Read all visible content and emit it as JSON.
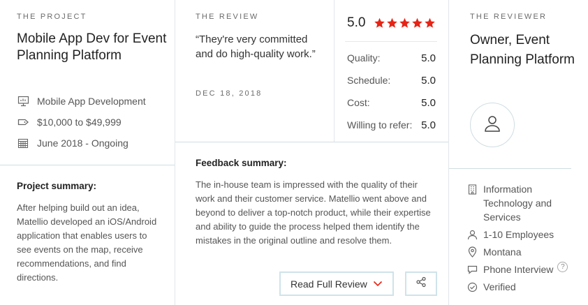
{
  "project": {
    "eyebrow": "THE PROJECT",
    "title": "Mobile App Dev for Event Planning Platform",
    "meta": [
      {
        "icon": "monitor-icon",
        "text": "Mobile App Development"
      },
      {
        "icon": "price-tag-icon",
        "text": "$10,000 to $49,999"
      },
      {
        "icon": "calendar-icon",
        "text": "June 2018 - Ongoing"
      }
    ],
    "summary_heading": "Project summary:",
    "summary_text": "After helping build out an idea, Matellio developed an iOS/Android application that enables users to see events on the map, receive recommendations, and find directions."
  },
  "review": {
    "eyebrow": "THE REVIEW",
    "quote": "“They're very committed and do high-quality work.”",
    "date": "DEC 18, 2018",
    "overall_score": "5.0",
    "stars_filled": 5,
    "star_color": "#e62415",
    "scores": [
      {
        "label": "Quality:",
        "value": "5.0"
      },
      {
        "label": "Schedule:",
        "value": "5.0"
      },
      {
        "label": "Cost:",
        "value": "5.0"
      },
      {
        "label": "Willing to refer:",
        "value": "5.0"
      }
    ],
    "feedback_heading": "Feedback summary:",
    "feedback_text": "The in-house team is impressed with the quality of their work and their customer service. Matellio went above and beyond to deliver a top-notch product, while their expertise and ability to guide the process helped them identify the mistakes in the original outline and resolve them.",
    "read_full_label": "Read Full Review",
    "chevron_color": "#e62415"
  },
  "reviewer": {
    "eyebrow": "THE REVIEWER",
    "title": "Owner, Event Planning Platform",
    "details": [
      {
        "icon": "building-icon",
        "text": "Information Technology and Services"
      },
      {
        "icon": "person-icon",
        "text": "1-10 Employees"
      },
      {
        "icon": "location-pin-icon",
        "text": "Montana"
      },
      {
        "icon": "chat-bubble-icon",
        "text": "Phone Interview",
        "help": "?"
      },
      {
        "icon": "check-circle-icon",
        "text": "Verified"
      }
    ]
  }
}
